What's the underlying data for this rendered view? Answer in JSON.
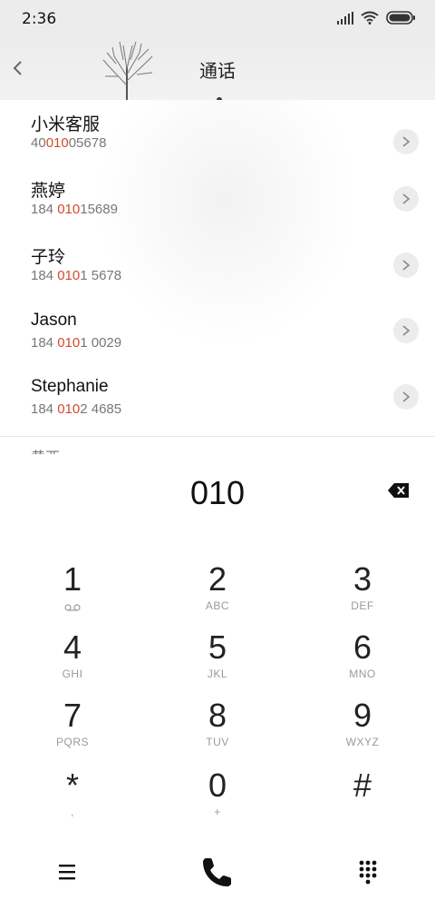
{
  "status": {
    "time": "2:36"
  },
  "header": {
    "title": "通话"
  },
  "contacts": [
    {
      "name": "小米客服",
      "num_pre": "40",
      "num_hl": "010",
      "num_post": "05678"
    },
    {
      "name": "燕婷",
      "num_pre": "184 ",
      "num_hl": "010",
      "num_post": "15689"
    },
    {
      "name": "子玲",
      "num_pre": "184 ",
      "num_hl": "010",
      "num_post": "1 5678"
    },
    {
      "name": "Jason",
      "num_pre": "184 ",
      "num_hl": "010",
      "num_post": "1 0029"
    },
    {
      "name": "Stephanie",
      "num_pre": "184 ",
      "num_hl": "010",
      "num_post": "2 4685"
    }
  ],
  "partial_contact": {
    "name": "黄西"
  },
  "dialer": {
    "input": "010",
    "keys": [
      {
        "digit": "1",
        "letters": "voicemail"
      },
      {
        "digit": "2",
        "letters": "ABC"
      },
      {
        "digit": "3",
        "letters": "DEF"
      },
      {
        "digit": "4",
        "letters": "GHI"
      },
      {
        "digit": "5",
        "letters": "JKL"
      },
      {
        "digit": "6",
        "letters": "MNO"
      },
      {
        "digit": "7",
        "letters": "PQRS"
      },
      {
        "digit": "8",
        "letters": "TUV"
      },
      {
        "digit": "9",
        "letters": "WXYZ"
      },
      {
        "digit": "*",
        "letters": ","
      },
      {
        "digit": "0",
        "letters": "+"
      },
      {
        "digit": "#",
        "letters": ""
      }
    ]
  },
  "icons": {
    "status": [
      "signal-icon",
      "wifi-icon",
      "battery-icon"
    ],
    "bottom": [
      "menu-icon",
      "phone-icon",
      "keypad-icon"
    ]
  },
  "colors": {
    "highlight": "#d9472d",
    "header_bg": "#ececec"
  }
}
